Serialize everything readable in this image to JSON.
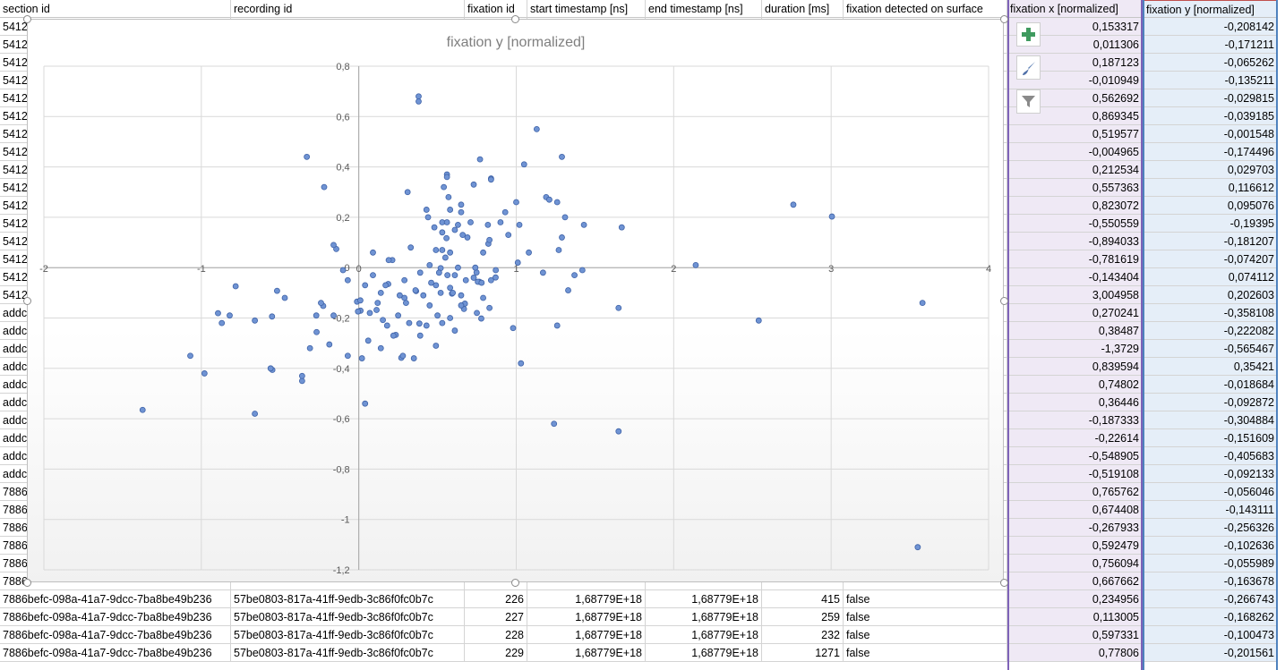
{
  "columns": {
    "a": "section id",
    "b": "recording id",
    "c": "fixation id",
    "d": "start timestamp [ns]",
    "e": "end timestamp [ns]",
    "f": "duration [ms]",
    "g": "fixation detected on surface",
    "h": "fixation x [normalized]",
    "i": "fixation y [normalized]"
  },
  "visible_rows": [
    {
      "a": "5412",
      "x": "0,153317",
      "y": "-0,208142"
    },
    {
      "a": "5412",
      "x": "0,011306",
      "y": "-0,171211"
    },
    {
      "a": "5412",
      "x": "0,187123",
      "y": "-0,065262"
    },
    {
      "a": "5412",
      "x": "-0,010949",
      "y": "-0,135211"
    },
    {
      "a": "5412",
      "x": "0,562692",
      "y": "-0,029815"
    },
    {
      "a": "5412",
      "x": "0,869345",
      "y": "-0,039185"
    },
    {
      "a": "5412",
      "x": "0,519577",
      "y": "-0,001548"
    },
    {
      "a": "5412",
      "x": "-0,004965",
      "y": "-0,174496"
    },
    {
      "a": "5412",
      "x": "0,212534",
      "y": "0,029703"
    },
    {
      "a": "5412",
      "x": "0,557363",
      "y": "0,116612"
    },
    {
      "a": "5412",
      "x": "0,823072",
      "y": "0,095076"
    },
    {
      "a": "5412",
      "x": "-0,550559",
      "y": "-0,19395"
    },
    {
      "a": "5412",
      "x": "-0,894033",
      "y": "-0,181207"
    },
    {
      "a": "5412",
      "x": "-0,781619",
      "y": "-0,074207"
    },
    {
      "a": "5412",
      "x": "-0,143404",
      "y": "0,074112"
    },
    {
      "a": "5412",
      "x": "3,004958",
      "y": "0,202603"
    },
    {
      "a": "addc",
      "x": "0,270241",
      "y": "-0,358108"
    },
    {
      "a": "addc",
      "x": "0,38487",
      "y": "-0,222082"
    },
    {
      "a": "addc",
      "x": "-1,3729",
      "y": "-0,565467"
    },
    {
      "a": "addc",
      "x": "0,839594",
      "y": "0,35421"
    },
    {
      "a": "addc",
      "x": "0,74802",
      "y": "-0,018684"
    },
    {
      "a": "addc",
      "x": "0,36446",
      "y": "-0,092872"
    },
    {
      "a": "addc",
      "x": "-0,187333",
      "y": "-0,304884"
    },
    {
      "a": "addc",
      "x": "-0,22614",
      "y": "-0,151609"
    },
    {
      "a": "addc",
      "x": "-0,548905",
      "y": "-0,405683"
    },
    {
      "a": "addc",
      "x": "-0,519108",
      "y": "-0,092133"
    },
    {
      "a": "7886",
      "x": "0,765762",
      "y": "-0,056046"
    },
    {
      "a": "7886",
      "x": "0,674408",
      "y": "-0,143111"
    },
    {
      "a": "7886",
      "x": "-0,267933",
      "y": "-0,256326"
    },
    {
      "a": "7886",
      "x": "0,592479",
      "y": "-0,102636"
    },
    {
      "a": "7886",
      "x": "0,756094",
      "y": "-0,055989"
    },
    {
      "a": "7886",
      "x": "0,667662",
      "y": "-0,163678"
    },
    {
      "a": "7886befc-098a-41a7-9dcc-7ba8be49b236",
      "b": "57be0803-817a-41ff-9edb-3c86f0fc0b7c",
      "c": "226",
      "d": "1,68779E+18",
      "e": "1,68779E+18",
      "f": "415",
      "g": "false",
      "x": "0,234956",
      "y": "-0,266743"
    },
    {
      "a": "7886befc-098a-41a7-9dcc-7ba8be49b236",
      "b": "57be0803-817a-41ff-9edb-3c86f0fc0b7c",
      "c": "227",
      "d": "1,68779E+18",
      "e": "1,68779E+18",
      "f": "259",
      "g": "false",
      "x": "0,113005",
      "y": "-0,168262"
    },
    {
      "a": "7886befc-098a-41a7-9dcc-7ba8be49b236",
      "b": "57be0803-817a-41ff-9edb-3c86f0fc0b7c",
      "c": "228",
      "d": "1,68779E+18",
      "e": "1,68779E+18",
      "f": "232",
      "g": "false",
      "x": "0,597331",
      "y": "-0,100473"
    },
    {
      "a": "7886befc-098a-41a7-9dcc-7ba8be49b236",
      "b": "57be0803-817a-41ff-9edb-3c86f0fc0b7c",
      "c": "229",
      "d": "1,68779E+18",
      "e": "1,68779E+18",
      "f": "1271",
      "g": "false",
      "x": "0,77806",
      "y": "-0,201561"
    }
  ],
  "chart_data": {
    "type": "scatter",
    "title": "fixation y [normalized]",
    "xlim": [
      -2,
      4
    ],
    "ylim": [
      -1.2,
      0.8
    ],
    "x_ticks": [
      "-2",
      "-1",
      "0",
      "1",
      "2",
      "3",
      "4"
    ],
    "y_ticks": [
      "0,8",
      "0,6",
      "0,4",
      "0,2",
      "0",
      "-0,2",
      "-0,4",
      "-0,6",
      "-0,8",
      "-1",
      "-1,2"
    ],
    "grid": true,
    "point_color": "#6f93d3",
    "points": [
      [
        0.153,
        -0.208
      ],
      [
        0.011,
        -0.171
      ],
      [
        0.187,
        -0.065
      ],
      [
        -0.011,
        -0.135
      ],
      [
        0.563,
        -0.03
      ],
      [
        0.869,
        -0.039
      ],
      [
        0.52,
        -0.002
      ],
      [
        -0.005,
        -0.174
      ],
      [
        0.213,
        0.03
      ],
      [
        0.557,
        0.117
      ],
      [
        0.823,
        0.095
      ],
      [
        -0.551,
        -0.194
      ],
      [
        -0.894,
        -0.181
      ],
      [
        -0.782,
        -0.074
      ],
      [
        -0.143,
        0.074
      ],
      [
        3.005,
        0.203
      ],
      [
        0.27,
        -0.358
      ],
      [
        0.385,
        -0.222
      ],
      [
        -1.373,
        -0.565
      ],
      [
        0.84,
        0.354
      ],
      [
        0.748,
        -0.019
      ],
      [
        0.364,
        -0.093
      ],
      [
        -0.187,
        -0.305
      ],
      [
        -0.226,
        -0.152
      ],
      [
        -0.549,
        -0.406
      ],
      [
        -0.519,
        -0.092
      ],
      [
        0.766,
        -0.056
      ],
      [
        0.674,
        -0.143
      ],
      [
        -0.268,
        -0.256
      ],
      [
        0.592,
        -0.103
      ],
      [
        0.756,
        -0.056
      ],
      [
        0.668,
        -0.164
      ],
      [
        0.235,
        -0.267
      ],
      [
        0.113,
        -0.168
      ],
      [
        0.597,
        -0.1
      ],
      [
        0.778,
        -0.202
      ],
      [
        0.38,
        0.68
      ],
      [
        0.38,
        0.66
      ],
      [
        1.13,
        0.55
      ],
      [
        0.77,
        0.43
      ],
      [
        1.29,
        0.44
      ],
      [
        -0.33,
        0.44
      ],
      [
        1.05,
        0.41
      ],
      [
        0.56,
        0.37
      ],
      [
        0.56,
        0.36
      ],
      [
        0.84,
        0.35
      ],
      [
        -0.22,
        0.32
      ],
      [
        0.73,
        0.33
      ],
      [
        0.54,
        0.32
      ],
      [
        1.19,
        0.28
      ],
      [
        1.21,
        0.27
      ],
      [
        1.26,
        0.26
      ],
      [
        0.65,
        0.25
      ],
      [
        0.31,
        0.3
      ],
      [
        0.57,
        0.28
      ],
      [
        1.0,
        0.26
      ],
      [
        0.43,
        0.23
      ],
      [
        0.58,
        0.23
      ],
      [
        0.65,
        0.22
      ],
      [
        0.93,
        0.22
      ],
      [
        0.44,
        0.2
      ],
      [
        1.31,
        0.2
      ],
      [
        0.53,
        0.18
      ],
      [
        0.56,
        0.18
      ],
      [
        0.63,
        0.17
      ],
      [
        0.71,
        0.18
      ],
      [
        0.82,
        0.17
      ],
      [
        0.9,
        0.18
      ],
      [
        1.02,
        0.17
      ],
      [
        1.43,
        0.17
      ],
      [
        0.48,
        0.16
      ],
      [
        0.61,
        0.15
      ],
      [
        1.67,
        0.16
      ],
      [
        0.53,
        0.14
      ],
      [
        0.66,
        0.13
      ],
      [
        0.69,
        0.12
      ],
      [
        0.95,
        0.13
      ],
      [
        1.29,
        0.12
      ],
      [
        0.83,
        0.11
      ],
      [
        0.33,
        0.08
      ],
      [
        0.49,
        0.07
      ],
      [
        0.53,
        0.07
      ],
      [
        0.58,
        0.06
      ],
      [
        0.79,
        0.06
      ],
      [
        1.08,
        0.06
      ],
      [
        1.27,
        0.07
      ],
      [
        0.19,
        0.03
      ],
      [
        0.09,
        0.06
      ],
      [
        0.55,
        0.04
      ],
      [
        1.01,
        0.02
      ],
      [
        0.45,
        0.01
      ],
      [
        0.63,
        0.0
      ],
      [
        0.74,
        0.0
      ],
      [
        0.87,
        -0.01
      ],
      [
        1.42,
        -0.01
      ],
      [
        0.39,
        -0.02
      ],
      [
        0.51,
        -0.02
      ],
      [
        0.61,
        -0.03
      ],
      [
        0.73,
        -0.04
      ],
      [
        1.17,
        -0.02
      ],
      [
        1.37,
        -0.03
      ],
      [
        0.09,
        -0.03
      ],
      [
        0.29,
        -0.05
      ],
      [
        0.46,
        -0.06
      ],
      [
        0.68,
        -0.05
      ],
      [
        0.78,
        -0.06
      ],
      [
        0.84,
        -0.05
      ],
      [
        0.04,
        -0.07
      ],
      [
        0.17,
        -0.07
      ],
      [
        0.36,
        -0.09
      ],
      [
        0.49,
        -0.07
      ],
      [
        0.58,
        -0.08
      ],
      [
        1.33,
        -0.09
      ],
      [
        0.26,
        -0.11
      ],
      [
        0.41,
        -0.11
      ],
      [
        0.52,
        -0.1
      ],
      [
        0.65,
        -0.11
      ],
      [
        0.79,
        -0.12
      ],
      [
        0.01,
        -0.13
      ],
      [
        0.3,
        -0.14
      ],
      [
        0.45,
        -0.15
      ],
      [
        0.65,
        -0.15
      ],
      [
        0.83,
        -0.16
      ],
      [
        1.65,
        -0.16
      ],
      [
        0.07,
        -0.18
      ],
      [
        0.25,
        -0.19
      ],
      [
        0.5,
        -0.19
      ],
      [
        0.58,
        -0.2
      ],
      [
        0.75,
        -0.18
      ],
      [
        0.32,
        -0.22
      ],
      [
        0.43,
        -0.23
      ],
      [
        0.53,
        -0.22
      ],
      [
        0.18,
        -0.23
      ],
      [
        1.26,
        -0.23
      ],
      [
        2.54,
        -0.21
      ],
      [
        0.06,
        -0.29
      ],
      [
        0.22,
        -0.27
      ],
      [
        0.39,
        -0.27
      ],
      [
        0.61,
        -0.25
      ],
      [
        0.98,
        -0.24
      ],
      [
        0.14,
        -0.32
      ],
      [
        0.49,
        -0.31
      ],
      [
        0.28,
        -0.35
      ],
      [
        0.35,
        -0.36
      ],
      [
        0.02,
        -0.36
      ],
      [
        1.03,
        -0.38
      ],
      [
        -0.07,
        -0.35
      ],
      [
        -1.07,
        -0.35
      ],
      [
        -0.98,
        -0.42
      ],
      [
        -0.36,
        -0.45
      ],
      [
        -0.56,
        -0.4
      ],
      [
        -0.82,
        -0.19
      ],
      [
        -0.66,
        -0.21
      ],
      [
        -0.66,
        -0.58
      ],
      [
        -0.87,
        -0.22
      ],
      [
        -0.47,
        -0.12
      ],
      [
        -0.07,
        -0.05
      ],
      [
        -0.1,
        -0.01
      ],
      [
        -0.16,
        0.09
      ],
      [
        -0.31,
        -0.32
      ],
      [
        -0.27,
        -0.19
      ],
      [
        -0.24,
        -0.14
      ],
      [
        -0.16,
        -0.19
      ],
      [
        -0.36,
        -0.43
      ],
      [
        2.76,
        0.25
      ],
      [
        2.14,
        0.01
      ],
      [
        3.58,
        -0.14
      ],
      [
        1.24,
        -0.62
      ],
      [
        1.65,
        -0.65
      ],
      [
        3.55,
        -1.11
      ],
      [
        0.04,
        -0.54
      ],
      [
        0.14,
        -0.1
      ],
      [
        0.29,
        -0.12
      ],
      [
        0.12,
        -0.14
      ]
    ]
  }
}
